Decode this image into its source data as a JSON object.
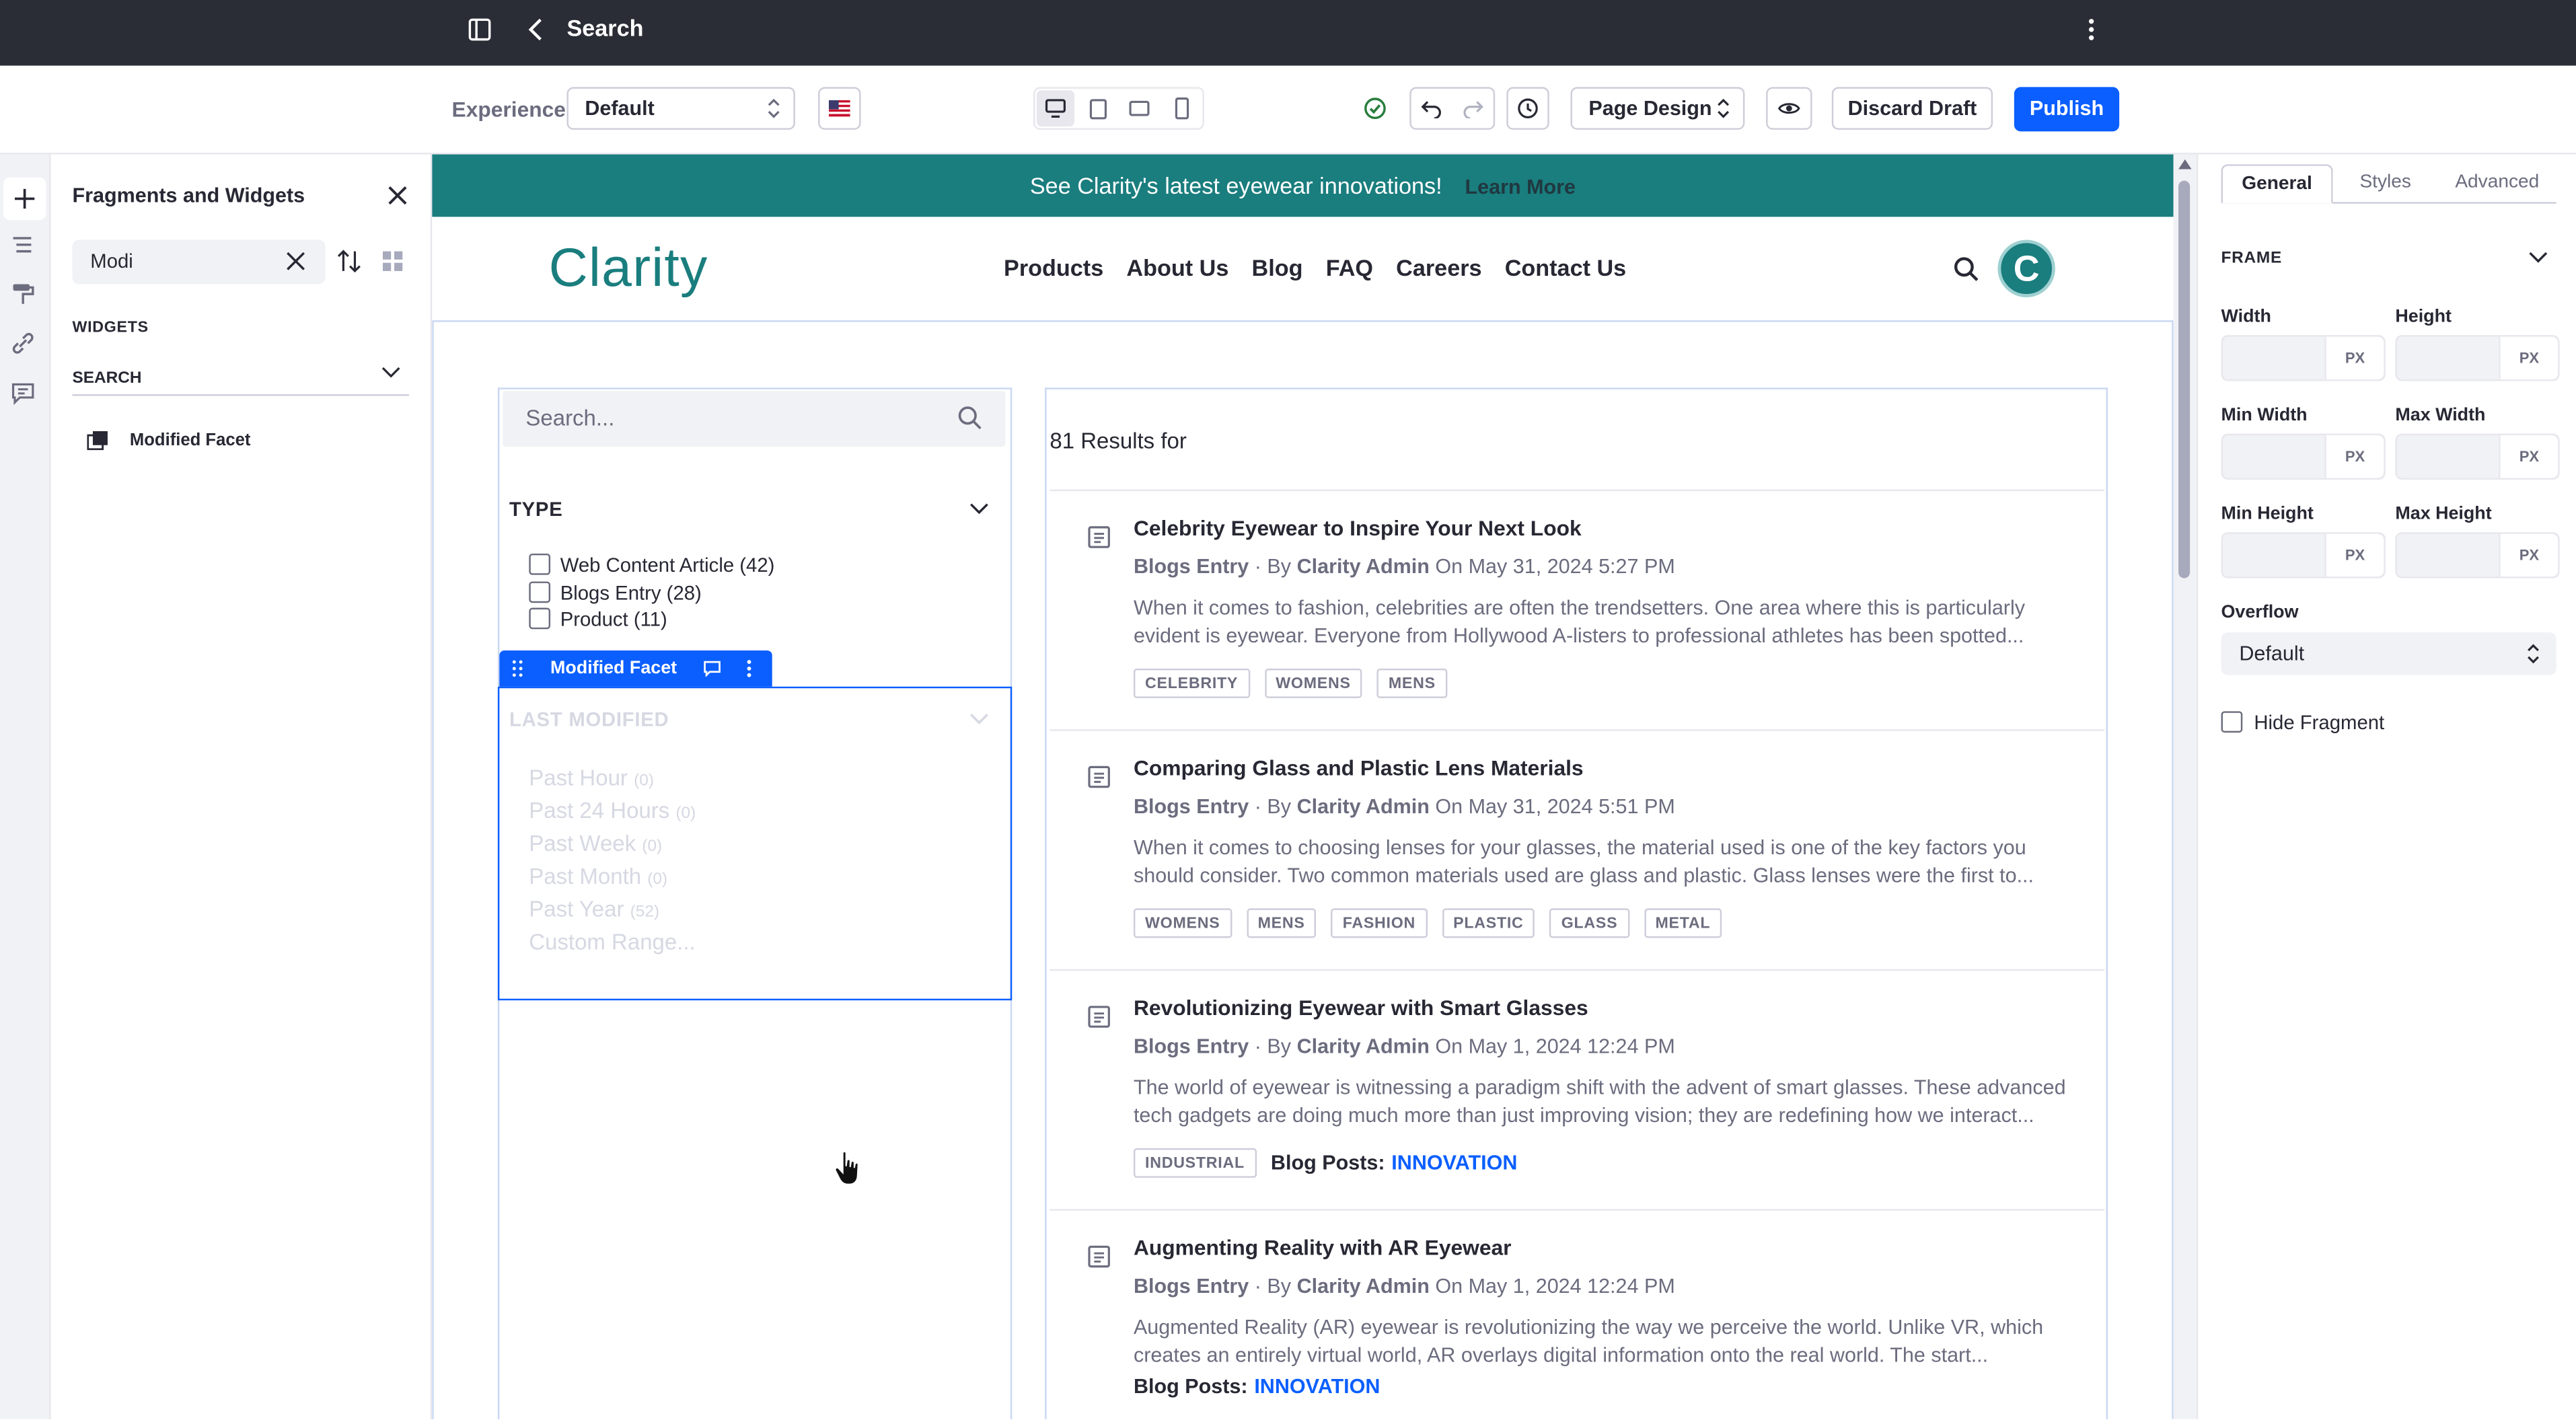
{
  "topbar": {
    "title": "Search"
  },
  "toolbar": {
    "experience_label": "Experience",
    "experience_value": "Default",
    "page_design_label": "Page Design",
    "discard_label": "Discard Draft",
    "publish_label": "Publish"
  },
  "fragments_panel": {
    "title": "Fragments and Widgets",
    "search_value": "Modi",
    "section_widgets": "WIDGETS",
    "category": "SEARCH",
    "widget_item": "Modified Facet"
  },
  "site": {
    "banner_text": "See Clarity's latest eyewear innovations!",
    "banner_link": "Learn More",
    "logo": "Clarity",
    "nav": [
      "Products",
      "About Us",
      "Blog",
      "FAQ",
      "Careers",
      "Contact Us"
    ],
    "avatar_letter": "C"
  },
  "search_widget": {
    "placeholder": "Search...",
    "type_facet": {
      "title": "TYPE",
      "options": [
        {
          "label": "Web Content Article (42)"
        },
        {
          "label": "Blogs Entry (28)"
        },
        {
          "label": "Product (11)"
        }
      ]
    },
    "topper_label": "Modified Facet",
    "modified_facet": {
      "title": "LAST MODIFIED",
      "options": [
        {
          "label": "Past Hour",
          "count": "(0)"
        },
        {
          "label": "Past 24 Hours",
          "count": "(0)"
        },
        {
          "label": "Past Week",
          "count": "(0)"
        },
        {
          "label": "Past Month",
          "count": "(0)"
        },
        {
          "label": "Past Year",
          "count": "(52)"
        },
        {
          "label": "Custom Range...",
          "count": ""
        }
      ]
    },
    "results_count": "81 Results for",
    "results": [
      {
        "title": "Celebrity Eyewear to Inspire Your Next Look",
        "type": "Blogs Entry",
        "by": "· By",
        "author": "Clarity Admin",
        "date": "On May 31, 2024 5:27 PM",
        "desc": "When it comes to fashion, celebrities are often the trendsetters. One area where this is particularly evident is eyewear. Everyone from Hollywood A-listers to professional athletes has been spotted...",
        "tags": [
          "CELEBRITY",
          "WOMENS",
          "MENS"
        ]
      },
      {
        "title": "Comparing Glass and Plastic Lens Materials",
        "type": "Blogs Entry",
        "by": "· By",
        "author": "Clarity Admin",
        "date": "On May 31, 2024 5:51 PM",
        "desc": "When it comes to choosing lenses for your glasses, the material used is one of the key factors you should consider. Two common materials used are glass and plastic. Glass lenses were the first to...",
        "tags": [
          "WOMENS",
          "MENS",
          "FASHION",
          "PLASTIC",
          "GLASS",
          "METAL"
        ]
      },
      {
        "title": "Revolutionizing Eyewear with Smart Glasses",
        "type": "Blogs Entry",
        "by": "· By",
        "author": "Clarity Admin",
        "date": "On May 1, 2024 12:24 PM",
        "desc": "The world of eyewear is witnessing a paradigm shift with the advent of smart glasses. These advanced tech gadgets are doing much more than just improving vision; they are redefining how we interact...",
        "tags": [
          "INDUSTRIAL"
        ],
        "category_label": "Blog Posts:",
        "category_value": "INNOVATION"
      },
      {
        "title": "Augmenting Reality with AR Eyewear",
        "type": "Blogs Entry",
        "by": "· By",
        "author": "Clarity Admin",
        "date": "On May 1, 2024 12:24 PM",
        "desc": "Augmented Reality (AR) eyewear is revolutionizing the way we perceive the world. Unlike VR, which creates an entirely virtual world, AR overlays digital information onto the real world. The start...",
        "tags": [],
        "category_label": "Blog Posts:",
        "category_value": "INNOVATION"
      }
    ]
  },
  "config_panel": {
    "tabs": [
      "General",
      "Styles",
      "Advanced"
    ],
    "frame_label": "FRAME",
    "unit": "PX",
    "width_label": "Width",
    "height_label": "Height",
    "min_width_label": "Min Width",
    "max_width_label": "Max Width",
    "min_height_label": "Min Height",
    "max_height_label": "Max Height",
    "overflow_label": "Overflow",
    "overflow_value": "Default",
    "hide_fragment_label": "Hide Fragment"
  },
  "colors": {
    "brand": "#1a7d7e",
    "primary": "#0b5fff",
    "topbar": "#2b2d36"
  }
}
